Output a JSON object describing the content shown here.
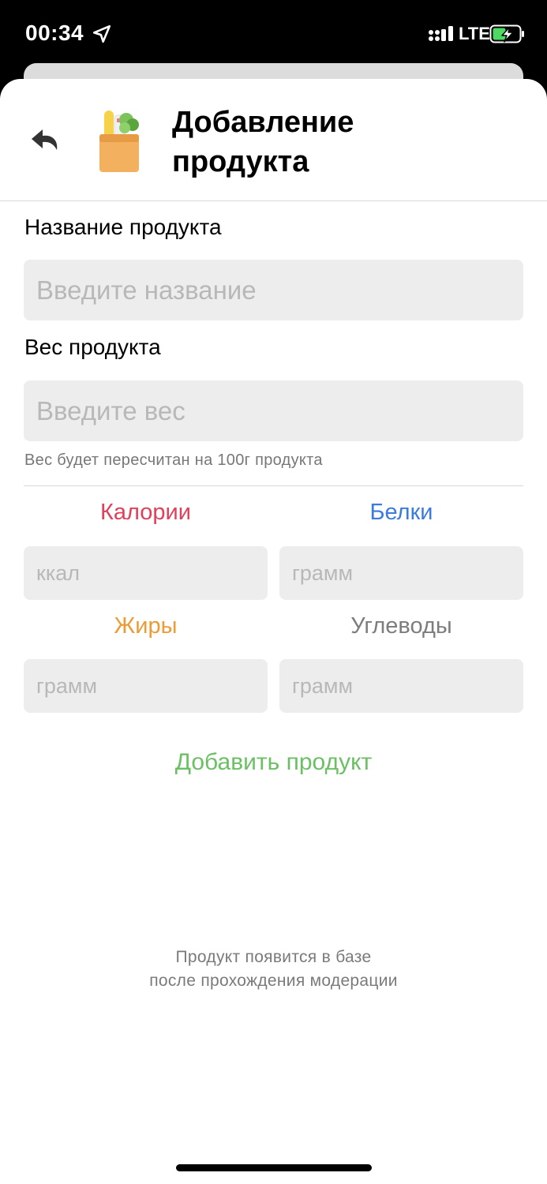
{
  "status_bar": {
    "time": "00:34",
    "network": "LTE",
    "icons": [
      "location-arrow-icon",
      "signal-icon",
      "battery-charging-icon"
    ]
  },
  "header": {
    "title_line1": "Добавление",
    "title_line2": "продукта",
    "icons": [
      "undo-back-icon",
      "grocery-bag-icon"
    ]
  },
  "form": {
    "name_label": "Название продукта",
    "name_placeholder": "Введите название",
    "weight_label": "Вес продукта",
    "weight_placeholder": "Введите вес",
    "weight_hint": "Вес будет пересчитан на 100г продукта",
    "calories_label": "Калории",
    "calories_placeholder": "ккал",
    "protein_label": "Белки",
    "protein_placeholder": "грамм",
    "fat_label": "Жиры",
    "fat_placeholder": "грамм",
    "carbs_label": "Углеводы",
    "carbs_placeholder": "грамм",
    "submit_label": "Добавить продукт"
  },
  "footer": {
    "note_line1": "Продукт появится в базе",
    "note_line2": "после прохождения модерации"
  },
  "colors": {
    "calories": "#e0405a",
    "protein": "#3a7be0",
    "fat": "#ee9a35",
    "carbs": "#7d7d7d",
    "submit": "#6cc064",
    "input_bg": "#ededed"
  }
}
